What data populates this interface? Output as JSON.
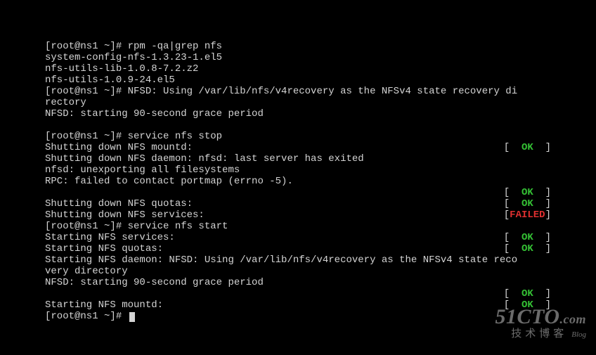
{
  "lines": [
    {
      "kind": "plain",
      "text": "[root@ns1 ~]# rpm -qa|grep nfs"
    },
    {
      "kind": "plain",
      "text": "system-config-nfs-1.3.23-1.el5"
    },
    {
      "kind": "plain",
      "text": "nfs-utils-lib-1.0.8-7.2.z2"
    },
    {
      "kind": "plain",
      "text": "nfs-utils-1.0.9-24.el5"
    },
    {
      "kind": "plain",
      "text": "[root@ns1 ~]# NFSD: Using /var/lib/nfs/v4recovery as the NFSv4 state recovery di"
    },
    {
      "kind": "plain",
      "text": "rectory"
    },
    {
      "kind": "plain",
      "text": "NFSD: starting 90-second grace period"
    },
    {
      "kind": "blank"
    },
    {
      "kind": "plain",
      "text": "[root@ns1 ~]# service nfs stop"
    },
    {
      "kind": "status",
      "label": "Shutting down NFS mountd:",
      "status": "OK"
    },
    {
      "kind": "plain",
      "text": "Shutting down NFS daemon: nfsd: last server has exited"
    },
    {
      "kind": "plain",
      "text": "nfsd: unexporting all filesystems"
    },
    {
      "kind": "plain",
      "text": "RPC: failed to contact portmap (errno -5)."
    },
    {
      "kind": "status",
      "label": "",
      "status": "OK"
    },
    {
      "kind": "status",
      "label": "Shutting down NFS quotas:",
      "status": "OK"
    },
    {
      "kind": "status",
      "label": "Shutting down NFS services:",
      "status": "FAILED"
    },
    {
      "kind": "plain",
      "text": "[root@ns1 ~]# service nfs start"
    },
    {
      "kind": "status",
      "label": "Starting NFS services:",
      "status": "OK"
    },
    {
      "kind": "status",
      "label": "Starting NFS quotas:",
      "status": "OK"
    },
    {
      "kind": "plain",
      "text": "Starting NFS daemon: NFSD: Using /var/lib/nfs/v4recovery as the NFSv4 state reco"
    },
    {
      "kind": "plain",
      "text": "very directory"
    },
    {
      "kind": "plain",
      "text": "NFSD: starting 90-second grace period"
    },
    {
      "kind": "status",
      "label": "",
      "status": "OK"
    },
    {
      "kind": "status",
      "label": "Starting NFS mountd:",
      "status": "OK"
    },
    {
      "kind": "prompt",
      "text": "[root@ns1 ~]# "
    }
  ],
  "status_strings": {
    "OK": {
      "open": "[  ",
      "word": "OK",
      "close": "  ]",
      "class": "ok"
    },
    "FAILED": {
      "open": "[",
      "word": "FAILED",
      "close": "]",
      "class": "failed"
    }
  },
  "watermark": {
    "brand_big": "51CTO",
    "brand_suffix": ".com",
    "sub": "技术博客",
    "sub2": "Blog"
  }
}
